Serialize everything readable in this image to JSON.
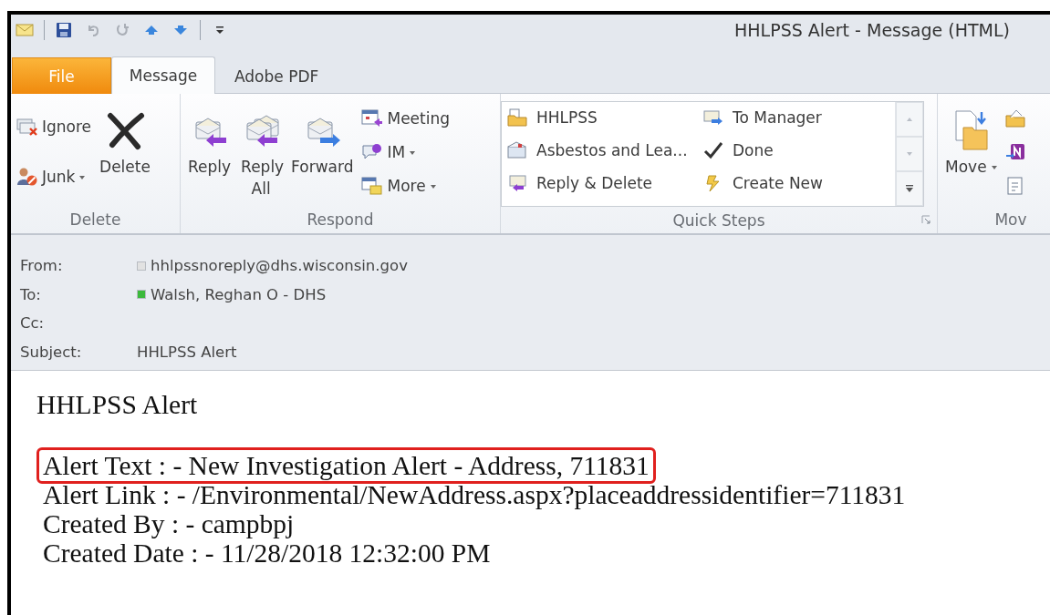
{
  "window": {
    "title": "HHLPSS Alert - Message (HTML)"
  },
  "tabs": [
    {
      "label": "File",
      "kind": "file",
      "selected": false
    },
    {
      "label": "Message",
      "kind": "tab",
      "selected": true
    },
    {
      "label": "Adobe PDF",
      "kind": "tab",
      "selected": false
    }
  ],
  "ribbon": {
    "groups": [
      {
        "label": "Delete",
        "launcher": false,
        "columns": [
          {
            "kind": "stack",
            "items": [
              {
                "label": "Ignore",
                "dropdown": false
              },
              {
                "label": "Junk",
                "dropdown": true
              }
            ]
          },
          {
            "kind": "large",
            "items": [
              {
                "label": "Delete",
                "dropdown": false
              }
            ]
          }
        ]
      },
      {
        "label": "Respond",
        "launcher": false,
        "columns": [
          {
            "kind": "large",
            "items": [
              {
                "label": "Reply",
                "dropdown": false
              }
            ]
          },
          {
            "kind": "large",
            "items": [
              {
                "label": "Reply All",
                "dropdown": false
              }
            ]
          },
          {
            "kind": "large",
            "items": [
              {
                "label": "Forward",
                "dropdown": false
              }
            ]
          },
          {
            "kind": "stack",
            "items": [
              {
                "label": "Meeting",
                "dropdown": false
              },
              {
                "label": "IM",
                "dropdown": true
              },
              {
                "label": "More",
                "dropdown": true
              }
            ]
          }
        ]
      },
      {
        "label": "Quick Steps",
        "launcher": true,
        "columns": [
          {
            "kind": "gallery",
            "items": [
              {
                "label": "HHLPSS"
              },
              {
                "label": "To Manager"
              },
              {
                "label": "Asbestos and Lea..."
              },
              {
                "label": "Done"
              },
              {
                "label": "Reply & Delete"
              },
              {
                "label": "Create New"
              }
            ]
          }
        ]
      },
      {
        "label": "Mov",
        "launcher": false,
        "columns": [
          {
            "kind": "large",
            "items": [
              {
                "label": "Move",
                "dropdown": true
              }
            ]
          },
          {
            "kind": "stack",
            "items": [
              {
                "dropdown": false
              },
              {
                "dropdown": false
              },
              {
                "dropdown": false
              }
            ]
          }
        ]
      }
    ]
  },
  "header": {
    "fields": [
      {
        "label": "From:",
        "value": "hhlpssnoreply@dhs.wisconsin.gov",
        "color": "#e2e2e2"
      },
      {
        "label": "To:",
        "value": "Walsh, Reghan O - DHS",
        "color": "#3cb93c"
      },
      {
        "label": "Cc:"
      },
      {
        "label": "Subject:",
        "value": "HHLPSS Alert"
      }
    ]
  },
  "body": {
    "heading": "HHLPSS Alert",
    "lines": [
      {
        "text": "Alert Text : - New Investigation Alert - Address, 711831",
        "highlighted": true
      },
      {
        "text": "Alert Link : - /Environmental/NewAddress.aspx?placeaddressidentifier=711831",
        "highlighted": false
      },
      {
        "text": "Created By : - campbpj",
        "highlighted": false
      },
      {
        "text": "Created Date : - 11/28/2018 12:32:00 PM",
        "highlighted": false
      }
    ]
  }
}
